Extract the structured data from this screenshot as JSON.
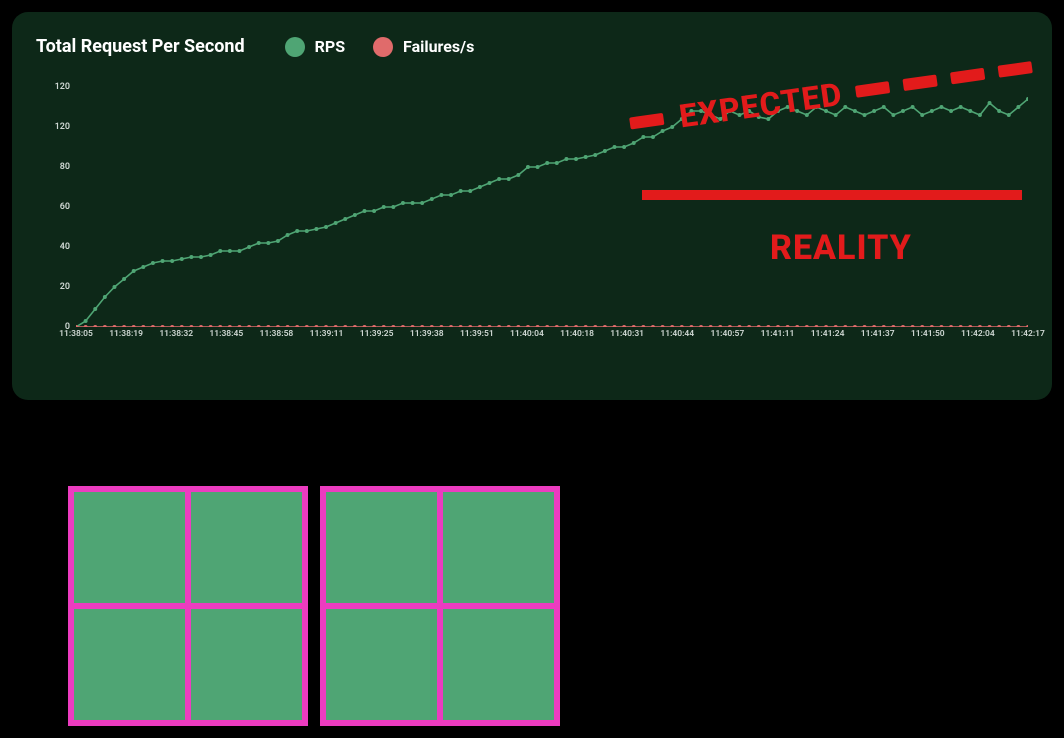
{
  "chart_data": {
    "type": "line",
    "title": "Total Request Per Second",
    "xlabel": "",
    "ylabel": "",
    "ylim": [
      0,
      120
    ],
    "y_ticks": [
      0,
      20,
      40,
      60,
      80,
      120,
      120
    ],
    "x_ticks": [
      "11:38:05",
      "11:38:19",
      "11:38:32",
      "11:38:45",
      "11:38:58",
      "11:39:11",
      "11:39:25",
      "11:39:38",
      "11:39:51",
      "11:40:04",
      "11:40:18",
      "11:40:31",
      "11:40:44",
      "11:40:57",
      "11:41:11",
      "11:41:24",
      "11:41:37",
      "11:41:50",
      "11:42:04",
      "11:42:17"
    ],
    "annotations": {
      "expected": "EXPECTED",
      "reality": "REALITY"
    },
    "series": [
      {
        "name": "RPS",
        "color": "#4fa574",
        "values": [
          0,
          3,
          9,
          15,
          20,
          24,
          28,
          30,
          32,
          33,
          33,
          34,
          35,
          35,
          36,
          38,
          38,
          38,
          40,
          42,
          42,
          43,
          46,
          48,
          48,
          49,
          50,
          52,
          54,
          56,
          58,
          58,
          60,
          60,
          62,
          62,
          62,
          64,
          66,
          66,
          68,
          68,
          70,
          72,
          74,
          74,
          76,
          80,
          80,
          82,
          82,
          84,
          84,
          85,
          86,
          88,
          90,
          90,
          92,
          95,
          95,
          98,
          100,
          104,
          108,
          108,
          106,
          104,
          108,
          106,
          108,
          105,
          104,
          108,
          110,
          108,
          106,
          110,
          108,
          106,
          110,
          108,
          106,
          108,
          110,
          106,
          108,
          110,
          106,
          108,
          110,
          108,
          110,
          108,
          106,
          112,
          108,
          106,
          110,
          114
        ]
      },
      {
        "name": "Failures/s",
        "color": "#e06b6b",
        "values": [
          0,
          0,
          0,
          0,
          0,
          0,
          0,
          0,
          0,
          0,
          0,
          0,
          0,
          0,
          0,
          0,
          0,
          0,
          0,
          0,
          0,
          0,
          0,
          0,
          0,
          0,
          0,
          0,
          0,
          0,
          0,
          0,
          0,
          0,
          0,
          0,
          0,
          0,
          0,
          0,
          0,
          0,
          0,
          0,
          0,
          0,
          0,
          0,
          0,
          0,
          0,
          0,
          0,
          0,
          0,
          0,
          0,
          0,
          0,
          0,
          0,
          0,
          0,
          0,
          0,
          0,
          0,
          0,
          0,
          0,
          0,
          0,
          0,
          0,
          0,
          0,
          0,
          0,
          0,
          0,
          0,
          0,
          0,
          0,
          0,
          0,
          0,
          0,
          0,
          0,
          0,
          0,
          0,
          0,
          0,
          0,
          0,
          0,
          0,
          0
        ]
      }
    ]
  },
  "legend": {
    "rps": "RPS",
    "failures": "Failures/s"
  }
}
